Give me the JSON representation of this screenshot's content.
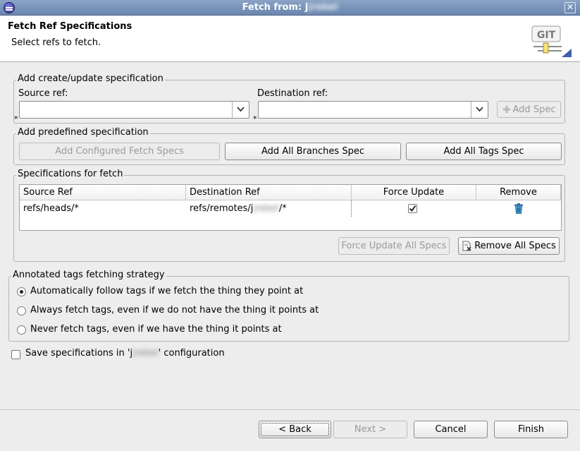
{
  "window": {
    "title_prefix": "Fetch from: j",
    "title_redacted": "jrebel",
    "close_glyph": "✕",
    "app_icon": "eclipse-icon"
  },
  "banner": {
    "title": "Fetch Ref Specifications",
    "description": "Select refs to fetch.",
    "logo_text": "GIT"
  },
  "create_group": {
    "label": "Add create/update specification",
    "source_label": "Source ref:",
    "source_value": "",
    "destination_label": "Destination ref:",
    "destination_value": "",
    "required_marker": "*",
    "add_spec_label": "Add Spec"
  },
  "predefined_group": {
    "label": "Add predefined specification",
    "configured_label": "Add Configured Fetch Specs",
    "branches_label": "Add All Branches Spec",
    "tags_label": "Add All Tags Spec"
  },
  "specs_group": {
    "label": "Specifications for fetch",
    "columns": [
      "Source Ref",
      "Destination Ref",
      "Force Update",
      "Remove"
    ],
    "rows": [
      {
        "source": "refs/heads/*",
        "destination_prefix": "refs/remotes/j",
        "destination_redacted": "jrebel",
        "destination_suffix": "/*",
        "force_update": true
      }
    ],
    "force_all_label": "Force Update All Specs",
    "remove_all_label": "Remove All Specs"
  },
  "tags_group": {
    "label": "Annotated tags fetching strategy",
    "options": [
      {
        "label": "Automatically follow tags if we fetch the thing they point at",
        "selected": true
      },
      {
        "label": "Always fetch tags, even if we do not have the thing it points at",
        "selected": false
      },
      {
        "label": "Never fetch tags, even if we have the thing it points at",
        "selected": false
      }
    ]
  },
  "save": {
    "prefix": "Save specifications in 'j",
    "redacted": "jrebel",
    "suffix": "' configuration",
    "checked": false
  },
  "footer": {
    "back_label": "< Back",
    "next_label": "Next >",
    "cancel_label": "Cancel",
    "finish_label": "Finish"
  }
}
